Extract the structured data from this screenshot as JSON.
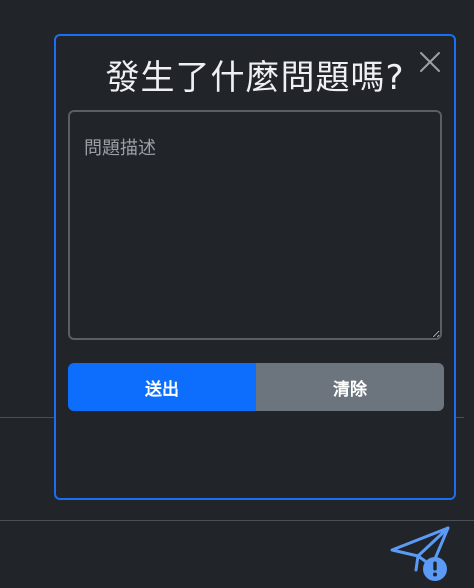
{
  "dialog": {
    "title": "發生了什麼問題嗎?",
    "description_placeholder": "問題描述",
    "submit_label": "送出",
    "clear_label": "清除"
  },
  "icons": {
    "close": "close-icon",
    "feedback": "paper-plane-alert-icon"
  },
  "colors": {
    "accent": "#0d6efd",
    "secondary": "#6c747e",
    "background": "#212429",
    "border": "#1a6ff0"
  }
}
